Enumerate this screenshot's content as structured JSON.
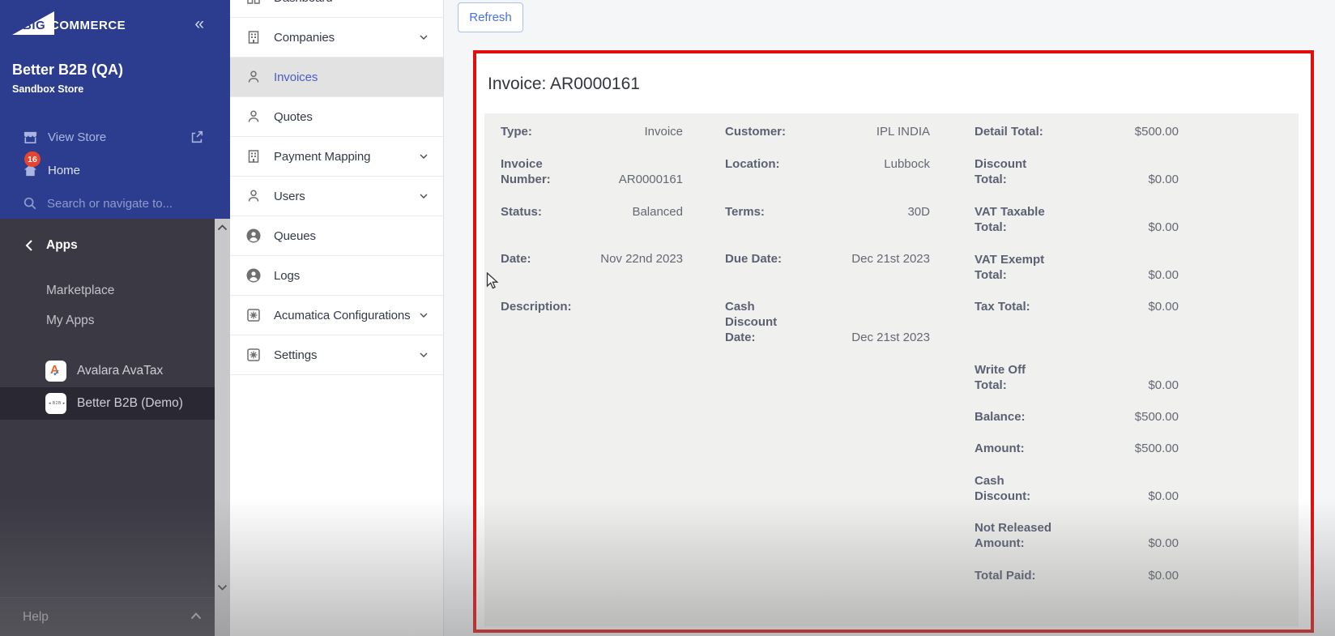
{
  "sidebar": {
    "logo": {
      "big": "BIG",
      "commerce": "COMMERCE"
    },
    "collapse_icon": "«",
    "store_name": "Better B2B (QA)",
    "store_subtitle": "Sandbox Store",
    "view_store": "View Store",
    "home": "Home",
    "home_badge": "16",
    "search_placeholder": "Search or navigate to...",
    "apps_header": "Apps",
    "marketplace": "Marketplace",
    "my_apps": "My Apps",
    "installed_apps": [
      {
        "name": "Avalara AvaTax"
      },
      {
        "name": "Better B2B (Demo)"
      }
    ],
    "help": "Help"
  },
  "app_nav": {
    "items": [
      {
        "label": "Dashboard"
      },
      {
        "label": "Companies"
      },
      {
        "label": "Invoices"
      },
      {
        "label": "Quotes"
      },
      {
        "label": "Payment Mapping"
      },
      {
        "label": "Users"
      },
      {
        "label": "Queues"
      },
      {
        "label": "Logs"
      },
      {
        "label": "Acumatica Configurations"
      },
      {
        "label": "Settings"
      }
    ]
  },
  "toolbar": {
    "refresh": "Refresh"
  },
  "invoice": {
    "title": "Invoice: AR0000161",
    "col1": [
      {
        "label": [
          "Type:"
        ],
        "value": "Invoice"
      },
      {
        "label": [
          "Invoice",
          "Number:"
        ],
        "value": "AR0000161"
      },
      {
        "label": [
          "Status:"
        ],
        "value": "Balanced"
      },
      {
        "label": [
          "Date:"
        ],
        "value": "Nov 22nd 2023"
      },
      {
        "label": [
          "Description:"
        ],
        "value": ""
      }
    ],
    "col2": [
      {
        "label": [
          "Customer:"
        ],
        "value": "IPL INDIA"
      },
      {
        "label": [
          "Location:"
        ],
        "value": "Lubbock"
      },
      {
        "label": [
          "Terms:"
        ],
        "value": "30D"
      },
      {
        "label": [
          "Due Date:"
        ],
        "value": "Dec 21st 2023"
      },
      {
        "label": [
          "Cash",
          "Discount",
          "Date:"
        ],
        "value": "Dec 21st 2023"
      }
    ],
    "col3": [
      {
        "label": [
          "Detail Total:"
        ],
        "value": "$500.00"
      },
      {
        "label": [
          "Discount",
          "Total:"
        ],
        "value": "$0.00"
      },
      {
        "label": [
          "VAT Taxable",
          "Total:"
        ],
        "value": "$0.00"
      },
      {
        "label": [
          "VAT Exempt",
          "Total:"
        ],
        "value": "$0.00"
      },
      {
        "label": [
          "Tax Total:"
        ],
        "value": "$0.00"
      },
      {
        "label": [
          "Write Off",
          "Total:"
        ],
        "value": "$0.00"
      },
      {
        "label": [
          "Balance:"
        ],
        "value": "$500.00"
      },
      {
        "label": [
          "Amount:"
        ],
        "value": "$500.00"
      },
      {
        "label": [
          "Cash",
          "Discount:"
        ],
        "value": "$0.00"
      },
      {
        "label": [
          "Not Released",
          "Amount:"
        ],
        "value": "$0.00"
      },
      {
        "label": [
          "Total Paid:"
        ],
        "value": "$0.00"
      }
    ]
  },
  "colors": {
    "sidebar_blue": "#2c3d8f",
    "sidebar_dark": "#3b3944",
    "active_item_blue": "#4d5cc5",
    "link_blue": "#4a70e0",
    "annotation_red": "#e20d0d",
    "badge_red": "#e8432f"
  }
}
